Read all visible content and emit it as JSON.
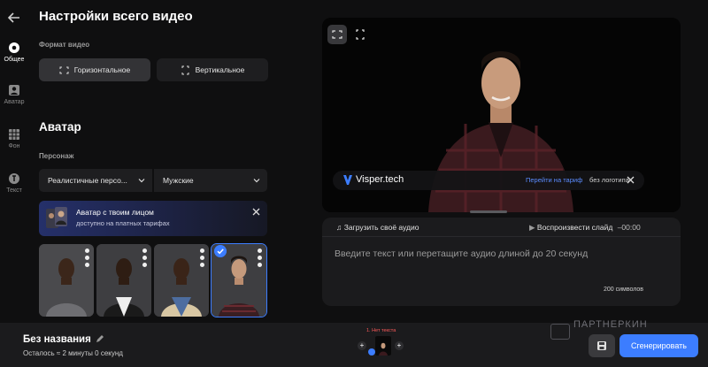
{
  "rail": {
    "items": [
      {
        "label": "Общее",
        "icon": "gear-icon",
        "active": true
      },
      {
        "label": "Аватар",
        "icon": "avatar-icon",
        "active": false
      },
      {
        "label": "Фон",
        "icon": "background-icon",
        "active": false
      },
      {
        "label": "Текст",
        "icon": "text-icon",
        "active": false
      }
    ]
  },
  "panel": {
    "title": "Настройки всего видео",
    "format_label": "Формат видео",
    "format_horizontal": "Горизонтальное",
    "format_vertical": "Вертикальное",
    "avatar_title": "Аватар",
    "character_label": "Персонаж",
    "select_type": "Реалистичные персо...",
    "select_gender": "Мужские",
    "promo_title": "Аватар с твоим лицом",
    "promo_sub": "доступно на платных тарифах"
  },
  "preview": {
    "brand": "Visper.tech",
    "upgrade_link": "Перейти на тариф",
    "no_logo": "без логотипа"
  },
  "script": {
    "upload": "Загрузить своё аудио",
    "play": "Воспроизвести слайд",
    "time": "–00:00",
    "placeholder": "Введите текст или перетащите аудио длиной до 20 секунд",
    "count": "200 символов"
  },
  "bottom": {
    "title": "Без названия",
    "remaining": "Осталось ≈ 2 минуты 0 секунд",
    "slide_label": "1. Нет текста",
    "watermark": "ПАРТНЕРКИН",
    "generate": "Сгенерировать"
  },
  "colors": {
    "accent": "#3c7dff",
    "bg": "#0f0f10",
    "panel": "#1b1b1d"
  }
}
